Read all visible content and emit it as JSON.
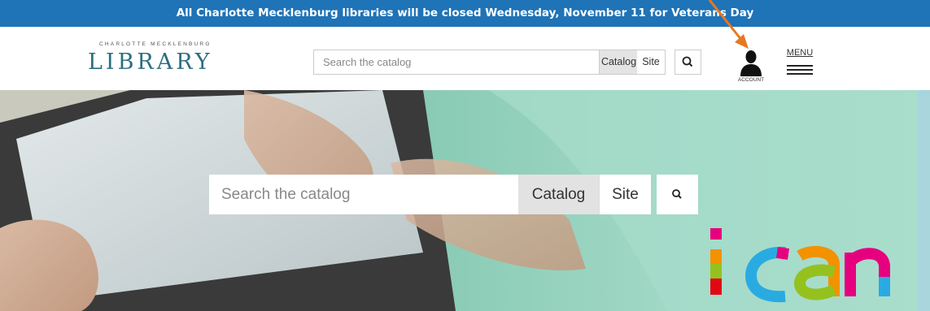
{
  "alert": {
    "text": "All Charlotte Mecklenburg libraries will be closed Wednesday, November 11 for Veterans Day"
  },
  "header": {
    "logo_small": "CHARLOTTE MECKLENBURG",
    "logo_main": "LIBRARY",
    "search": {
      "placeholder": "Search the catalog",
      "catalog_label": "Catalog",
      "site_label": "Site"
    },
    "account_label": "ACCOUNT",
    "menu_label": "MENU"
  },
  "hero": {
    "search": {
      "placeholder": "Search the catalog",
      "catalog_label": "Catalog",
      "site_label": "Site"
    },
    "slogan": "ican"
  },
  "colors": {
    "alert_bg": "#1f73b7",
    "logo_text": "#2c6e80",
    "annotation_arrow": "#e87722"
  },
  "icons": [
    "search-icon",
    "account-person-icon",
    "hamburger-menu-icon",
    "annotation-arrow-icon"
  ]
}
